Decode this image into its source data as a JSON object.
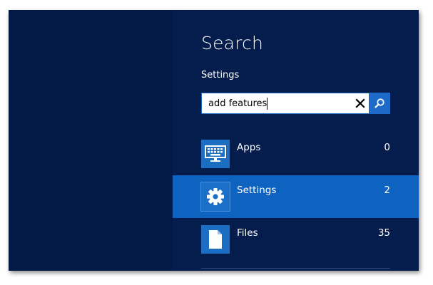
{
  "charm": {
    "title": "Search",
    "scope_label": "Settings"
  },
  "search": {
    "value": "add features",
    "placeholder": ""
  },
  "results": [
    {
      "label": "Apps",
      "count": "0",
      "icon": "keyboard-icon",
      "selected": false
    },
    {
      "label": "Settings",
      "count": "2",
      "icon": "gear-icon",
      "selected": true
    },
    {
      "label": "Files",
      "count": "35",
      "icon": "document-icon",
      "selected": false
    }
  ],
  "colors": {
    "background": "#031a46",
    "pane": "#051d4d",
    "selected_row": "#0e62c0",
    "tile": "#1b6ec2",
    "accent": "#1e6ac9"
  }
}
